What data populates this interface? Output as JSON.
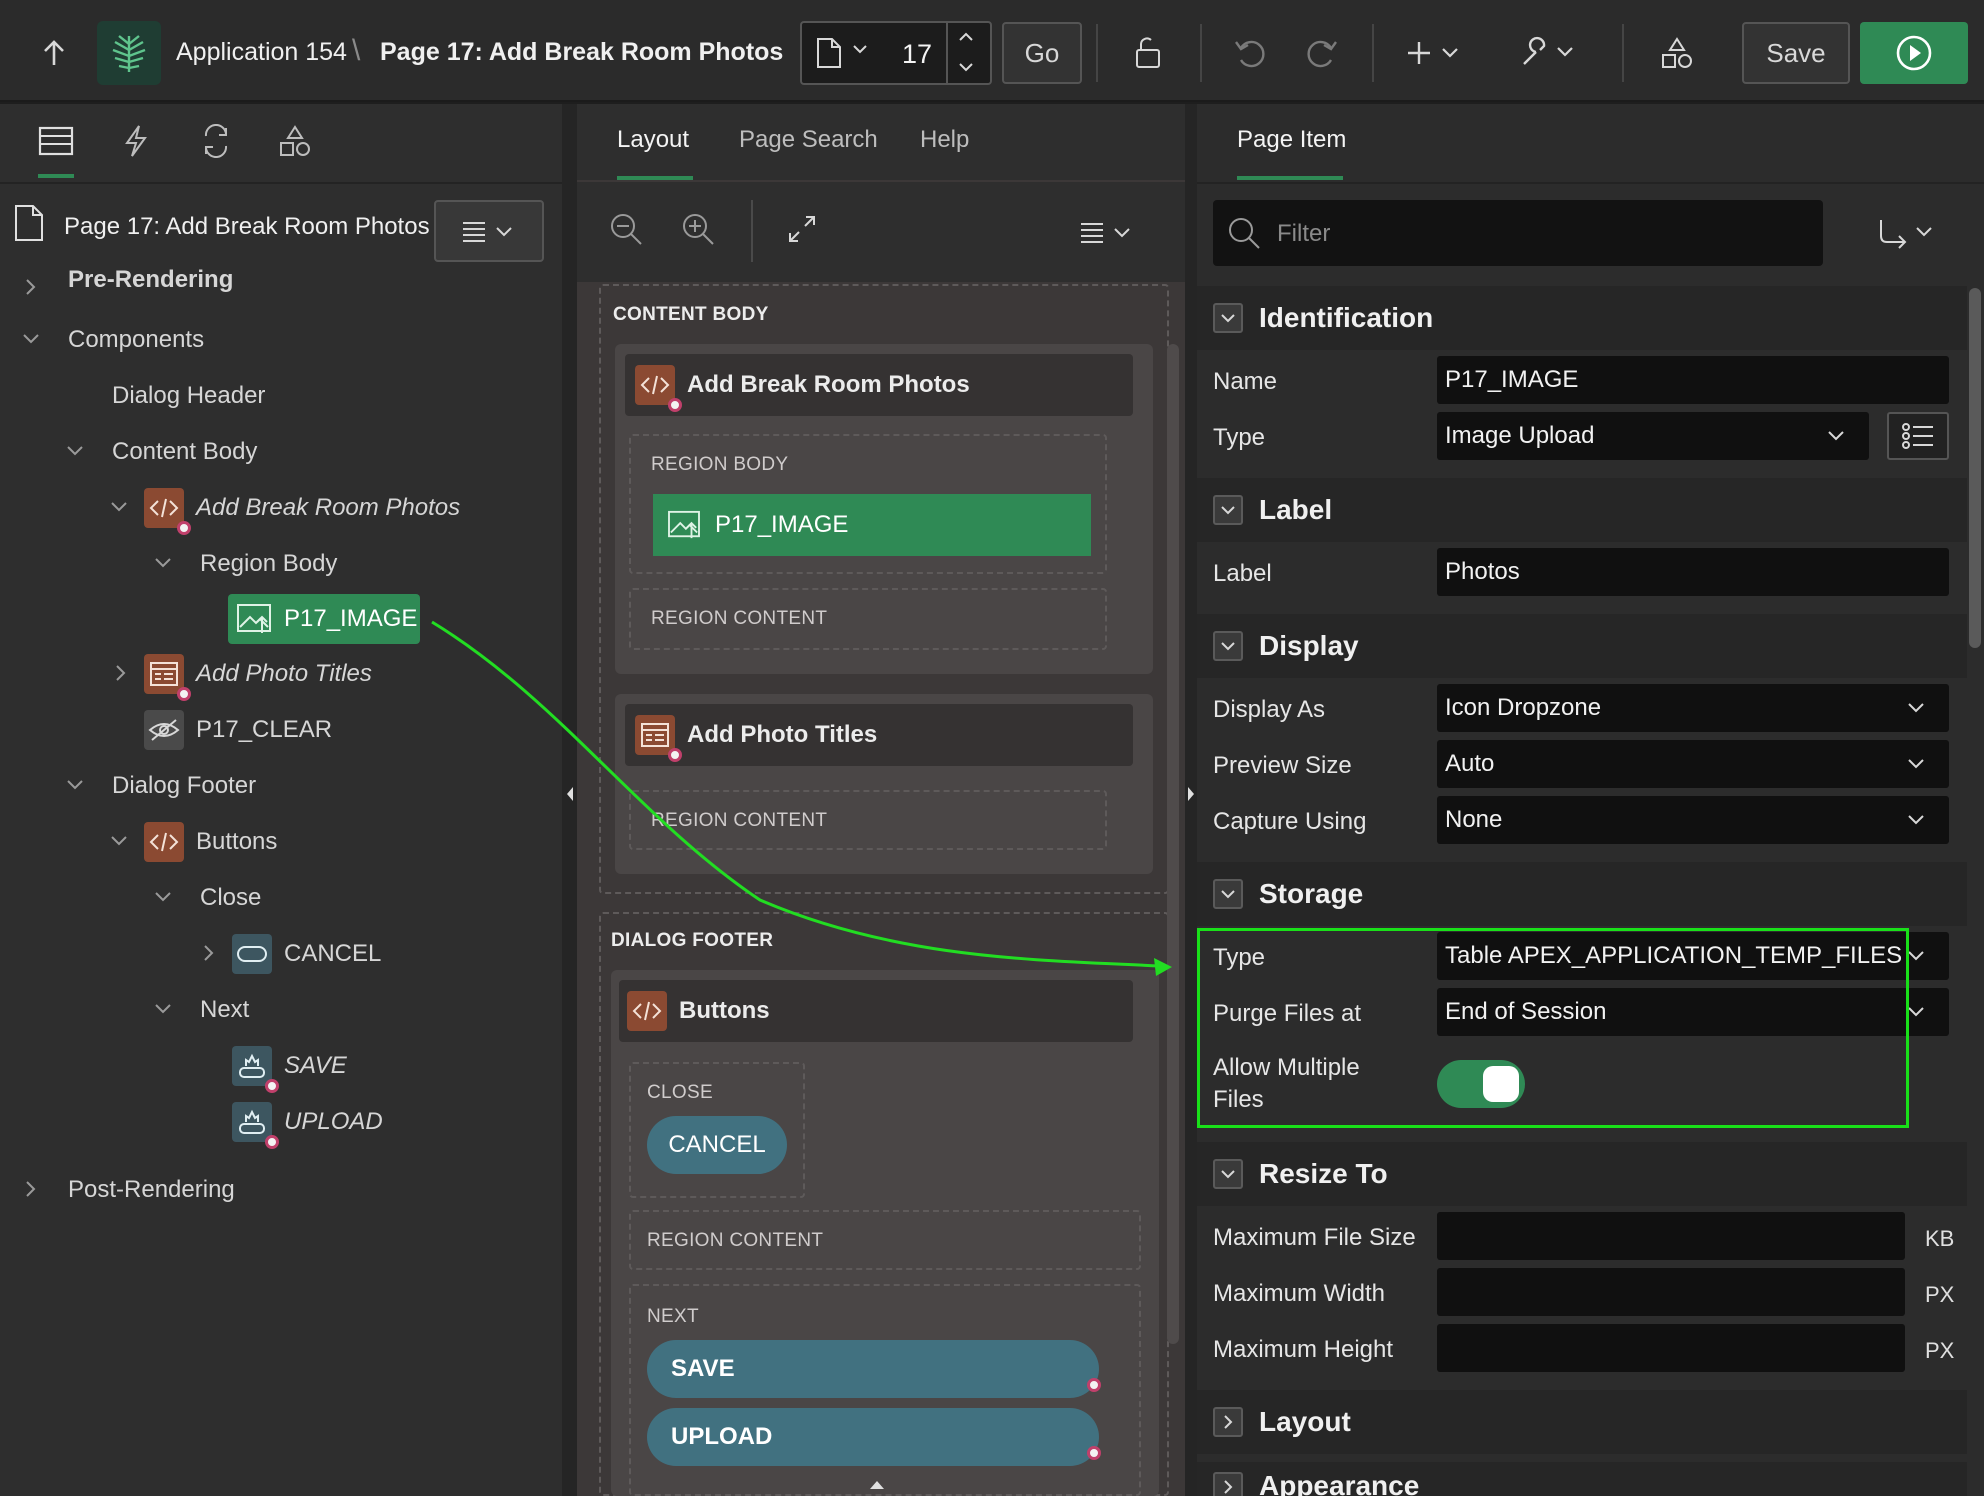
{
  "topbar": {
    "app_name": "Application 154",
    "separator": "\\",
    "page_title": "Page 17: Add Break Room Photos",
    "page_number": "17",
    "go_label": "Go",
    "save_label": "Save"
  },
  "left_panel": {
    "page_label": "Page 17: Add Break Room Photos",
    "tree": {
      "pre_rendering": "Pre-Rendering",
      "components": "Components",
      "dialog_header": "Dialog Header",
      "content_body": "Content Body",
      "add_break_room_photos": "Add Break Room Photos",
      "region_body": "Region Body",
      "p17_image": "P17_IMAGE",
      "add_photo_titles": "Add Photo Titles",
      "p17_clear": "P17_CLEAR",
      "dialog_footer": "Dialog Footer",
      "buttons": "Buttons",
      "close": "Close",
      "cancel": "CANCEL",
      "next": "Next",
      "save": "SAVE",
      "upload": "UPLOAD",
      "post_rendering": "Post-Rendering"
    }
  },
  "center_panel": {
    "tabs": [
      "Layout",
      "Page Search",
      "Help"
    ],
    "content_body": "CONTENT BODY",
    "region1_title": "Add Break Room Photos",
    "region_body": "REGION BODY",
    "p17_image": "P17_IMAGE",
    "region_content": "REGION CONTENT",
    "region2_title": "Add Photo Titles",
    "dialog_footer": "DIALOG FOOTER",
    "buttons_title": "Buttons",
    "close": "CLOSE",
    "cancel": "CANCEL",
    "next": "NEXT",
    "save": "SAVE",
    "upload": "UPLOAD"
  },
  "right_panel": {
    "tab": "Page Item",
    "filter_placeholder": "Filter",
    "identification": {
      "title": "Identification",
      "name_label": "Name",
      "name_value": "P17_IMAGE",
      "type_label": "Type",
      "type_value": "Image Upload"
    },
    "label_section": {
      "title": "Label",
      "label_label": "Label",
      "label_value": "Photos"
    },
    "display": {
      "title": "Display",
      "display_as_label": "Display As",
      "display_as_value": "Icon Dropzone",
      "preview_size_label": "Preview Size",
      "preview_size_value": "Auto",
      "capture_using_label": "Capture Using",
      "capture_using_value": "None"
    },
    "storage": {
      "title": "Storage",
      "type_label": "Type",
      "type_value": "Table APEX_APPLICATION_TEMP_FILES",
      "purge_label": "Purge Files at",
      "purge_value": "End of Session",
      "allow_multiple_line1": "Allow Multiple",
      "allow_multiple_line2": "Files",
      "allow_multiple_on": true
    },
    "resize": {
      "title": "Resize To",
      "max_file_size_label": "Maximum File Size",
      "max_file_size_unit": "KB",
      "max_width_label": "Maximum Width",
      "max_width_unit": "PX",
      "max_height_label": "Maximum Height",
      "max_height_unit": "PX"
    },
    "layout_title": "Layout",
    "appearance_title": "Appearance"
  },
  "colors": {
    "accent_green": "#2f8a55",
    "highlight_box": "#19e019",
    "annotation_arrow": "#22dd22",
    "region_icon": "#8b4a32",
    "button_teal": "#417180"
  }
}
